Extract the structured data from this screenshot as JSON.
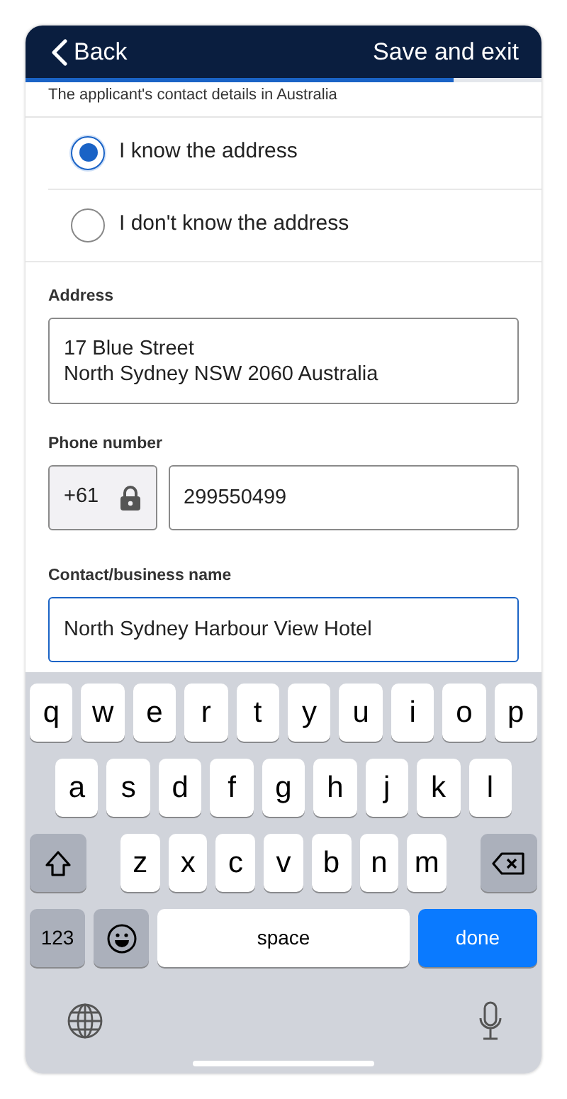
{
  "header": {
    "back": "Back",
    "action": "Save and exit",
    "progress": {
      "level": 0.83
    }
  },
  "section_heading": "The applicant's contact details in Australia",
  "options": [
    {
      "label": "I know the address",
      "selected": true
    },
    {
      "label": "I don't know the address",
      "selected": false
    }
  ],
  "address": {
    "label": "Address",
    "lines": [
      "17 Blue Street",
      "North Sydney NSW 2060 Australia"
    ]
  },
  "phone": {
    "label": "Phone number",
    "code": "+61",
    "code_locked": true,
    "value": "299550499"
  },
  "contact_name": {
    "label": "Contact/business name",
    "value": "North Sydney Harbour View Hotel",
    "focused": true
  },
  "keyboard": {
    "rows": [
      {
        "keys": [
          {
            "kind": "letter",
            "text": "q"
          },
          {
            "kind": "letter",
            "text": "w"
          },
          {
            "kind": "letter",
            "text": "e"
          },
          {
            "kind": "letter",
            "text": "r"
          },
          {
            "kind": "letter",
            "text": "t"
          },
          {
            "kind": "letter",
            "text": "y"
          },
          {
            "kind": "letter",
            "text": "u"
          },
          {
            "kind": "letter",
            "text": "i"
          },
          {
            "kind": "letter",
            "text": "o"
          },
          {
            "kind": "letter",
            "text": "p"
          }
        ]
      },
      {
        "keys": [
          {
            "kind": "letter",
            "text": "a"
          },
          {
            "kind": "letter",
            "text": "s"
          },
          {
            "kind": "letter",
            "text": "d"
          },
          {
            "kind": "letter",
            "text": "f"
          },
          {
            "kind": "letter",
            "text": "g"
          },
          {
            "kind": "letter",
            "text": "h"
          },
          {
            "kind": "letter",
            "text": "j"
          },
          {
            "kind": "letter",
            "text": "k"
          },
          {
            "kind": "letter",
            "text": "l"
          }
        ]
      },
      {
        "keys": [
          {
            "kind": "shift"
          },
          {
            "kind": "letter",
            "text": "z"
          },
          {
            "kind": "letter",
            "text": "x"
          },
          {
            "kind": "letter",
            "text": "c"
          },
          {
            "kind": "letter",
            "text": "v"
          },
          {
            "kind": "letter",
            "text": "b"
          },
          {
            "kind": "letter",
            "text": "n"
          },
          {
            "kind": "letter",
            "text": "m"
          },
          {
            "kind": "backspace"
          }
        ]
      },
      {
        "keys": [
          {
            "kind": "numbers",
            "text": "123"
          },
          {
            "kind": "emoji"
          },
          {
            "kind": "space",
            "text": "space"
          },
          {
            "kind": "done",
            "text": "done"
          }
        ]
      }
    ]
  }
}
